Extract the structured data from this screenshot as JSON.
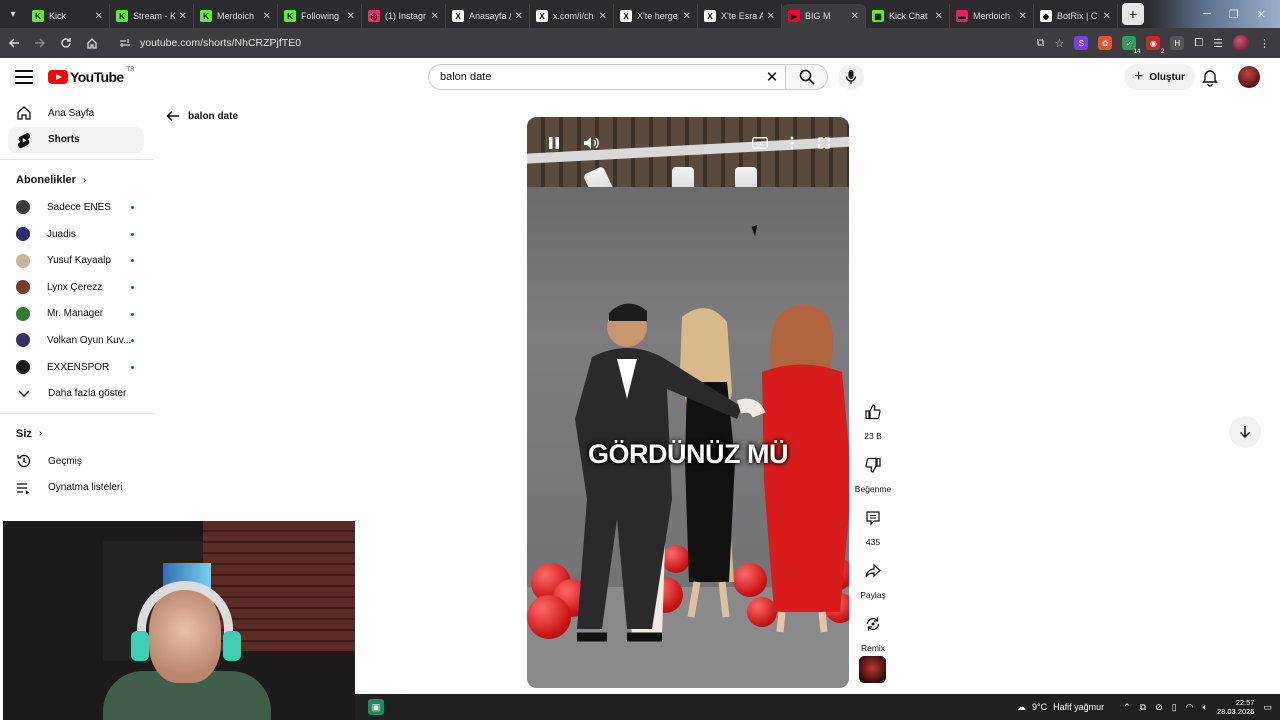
{
  "browser": {
    "tabs": [
      {
        "title": "Kick",
        "favicon": "kick-icon",
        "color": "#53fc18",
        "glyph": "K"
      },
      {
        "title": "Stream - K",
        "favicon": "kick-icon",
        "color": "#53fc18",
        "glyph": "K"
      },
      {
        "title": "Merdoich",
        "favicon": "kick-icon",
        "color": "#53fc18",
        "glyph": "K"
      },
      {
        "title": "Following",
        "favicon": "kick-icon",
        "color": "#53fc18",
        "glyph": "K"
      },
      {
        "title": "(1) Instagr",
        "favicon": "instagram-icon",
        "color": "#e1306c",
        "glyph": "◎"
      },
      {
        "title": "Anasayfa /",
        "favicon": "x-icon",
        "color": "#ffffff",
        "glyph": "X"
      },
      {
        "title": "x.com/i/ch",
        "favicon": "x-icon",
        "color": "#ffffff",
        "glyph": "X"
      },
      {
        "title": "X'te herge",
        "favicon": "x-icon",
        "color": "#ffffff",
        "glyph": "X"
      },
      {
        "title": "X'te Esra A",
        "favicon": "x-icon",
        "color": "#ffffff",
        "glyph": "X"
      },
      {
        "title": "BIG M",
        "favicon": "youtube-icon",
        "color": "#ff0033",
        "glyph": "▶",
        "active": true
      },
      {
        "title": "Kick Chat",
        "favicon": "kick-chat-icon",
        "color": "#53fc18",
        "glyph": "▦"
      },
      {
        "title": "Merdoich",
        "favicon": "kick-chat-icon",
        "color": "#e0245e",
        "glyph": "▬"
      },
      {
        "title": "BotRix | C",
        "favicon": "botrix-icon",
        "color": "#ffffff",
        "glyph": "◆"
      }
    ],
    "url": "youtube.com/shorts/NhCRZPjfTE0"
  },
  "header": {
    "logo_text": "YouTube",
    "country": "TR",
    "search_value": "balon date",
    "create_label": "Oluştur"
  },
  "guide": {
    "main": [
      {
        "label": "Ana Sayfa",
        "icon": "home-icon"
      },
      {
        "label": "Shorts",
        "icon": "shorts-icon",
        "selected": true
      }
    ],
    "subscriptions_title": "Abonelikler",
    "subscriptions": [
      {
        "label": "Sadece ENES",
        "color": "#3b3b3b"
      },
      {
        "label": "Juadis",
        "color": "#2d2b6e"
      },
      {
        "label": "Yusuf Kayaalp",
        "color": "#c7b49a"
      },
      {
        "label": "Lynx Çerezz",
        "color": "#7a3a2a"
      },
      {
        "label": "Mr. Manager",
        "color": "#2e7d32"
      },
      {
        "label": "Volkan Oyun Kuv...",
        "color": "#3a2f6b"
      },
      {
        "label": "EXXENSPOR",
        "color": "#1a1a1a"
      }
    ],
    "show_more": "Daha fazla göster",
    "you_title": "Siz",
    "you_items": [
      {
        "label": "Geçmiş",
        "icon": "history-icon"
      },
      {
        "label": "Oynatma listeleri",
        "icon": "playlists-icon"
      }
    ]
  },
  "main": {
    "back_query": "balon date",
    "overlay_text": "GÖRDÜNÜZ MÜ"
  },
  "actions": {
    "like_count": "23 B",
    "dislike_label": "Beğenme",
    "comment_count": "435",
    "share_label": "Paylaş",
    "remix_label": "Remix"
  },
  "taskbar": {
    "temperature": "9°C",
    "weather_text": "Hafif yağmur",
    "time": "22:57",
    "date": "28.03.2026"
  }
}
